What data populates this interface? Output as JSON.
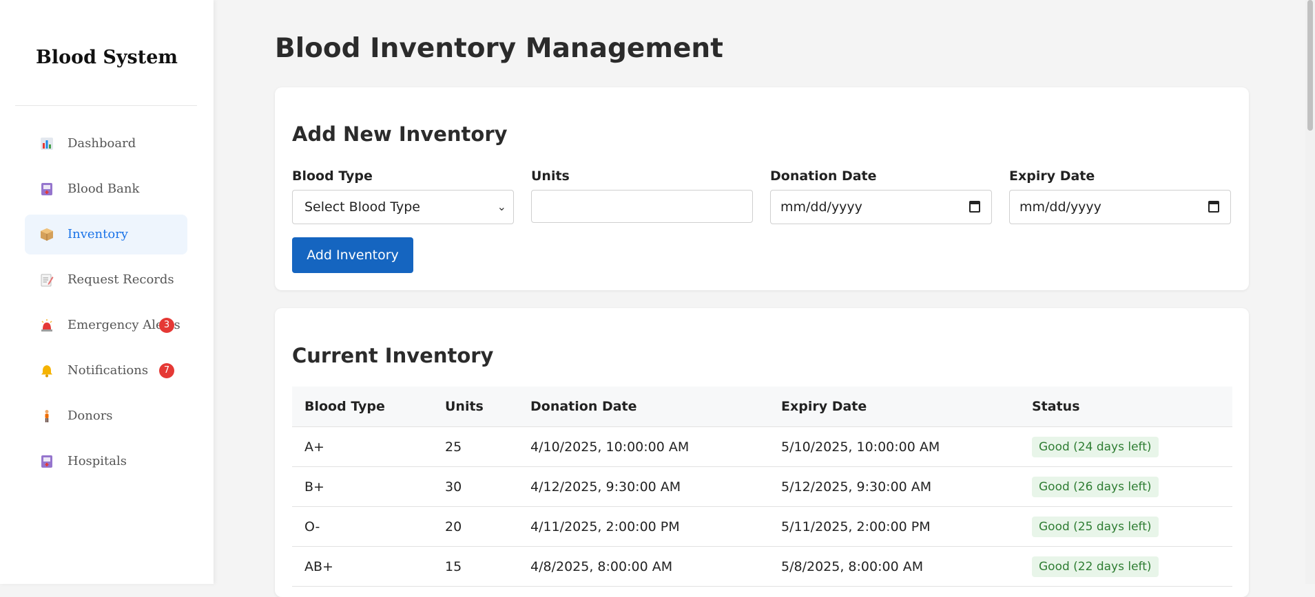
{
  "sidebar": {
    "brand": "Blood System",
    "items": [
      {
        "label": "Dashboard",
        "icon": "bar-chart-icon",
        "active": false
      },
      {
        "label": "Blood Bank",
        "icon": "blood-bank-icon",
        "active": false
      },
      {
        "label": "Inventory",
        "icon": "package-icon",
        "active": true
      },
      {
        "label": "Request Records",
        "icon": "memo-icon",
        "active": false
      },
      {
        "label": "Emergency Alerts",
        "icon": "siren-icon",
        "active": false,
        "badge": "3"
      },
      {
        "label": "Notifications",
        "icon": "bell-icon",
        "active": false,
        "badge": "7"
      },
      {
        "label": "Donors",
        "icon": "person-icon",
        "active": false
      },
      {
        "label": "Hospitals",
        "icon": "hospital-icon",
        "active": false
      }
    ]
  },
  "main": {
    "title": "Blood Inventory Management",
    "add_form": {
      "heading": "Add New Inventory",
      "blood_type_label": "Blood Type",
      "blood_type_value": "Select Blood Type",
      "units_label": "Units",
      "units_value": "",
      "donation_date_label": "Donation Date",
      "donation_date_placeholder": "mm/dd/yyyy",
      "expiry_date_label": "Expiry Date",
      "expiry_date_placeholder": "mm/dd/yyyy",
      "submit_label": "Add Inventory"
    },
    "inventory": {
      "heading": "Current Inventory",
      "columns": [
        "Blood Type",
        "Units",
        "Donation Date",
        "Expiry Date",
        "Status"
      ],
      "rows": [
        {
          "blood_type": "A+",
          "units": "25",
          "donation": "4/10/2025, 10:00:00 AM",
          "expiry": "5/10/2025, 10:00:00 AM",
          "status": "Good (24 days left)"
        },
        {
          "blood_type": "B+",
          "units": "30",
          "donation": "4/12/2025, 9:30:00 AM",
          "expiry": "5/12/2025, 9:30:00 AM",
          "status": "Good (26 days left)"
        },
        {
          "blood_type": "O-",
          "units": "20",
          "donation": "4/11/2025, 2:00:00 PM",
          "expiry": "5/11/2025, 2:00:00 PM",
          "status": "Good (25 days left)"
        },
        {
          "blood_type": "AB+",
          "units": "15",
          "donation": "4/8/2025, 8:00:00 AM",
          "expiry": "5/8/2025, 8:00:00 AM",
          "status": "Good (22 days left)"
        }
      ]
    }
  },
  "colors": {
    "accent": "#1565c0",
    "active_nav_bg": "#eef5fd",
    "badge": "#e53935",
    "status_good_bg": "#e8f5e9",
    "status_good_text": "#2e7d32"
  }
}
